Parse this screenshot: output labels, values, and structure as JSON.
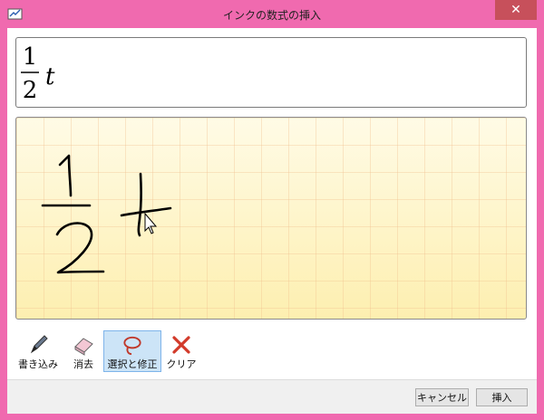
{
  "window": {
    "title": "インクの数式の挿入",
    "close_glyph": "✕"
  },
  "preview": {
    "numerator": "1",
    "denominator": "2",
    "variable": "t"
  },
  "toolbar": {
    "write_label": "書き込み",
    "erase_label": "消去",
    "select_correct_label": "選択と修正",
    "clear_label": "クリア"
  },
  "footer": {
    "cancel_label": "キャンセル",
    "insert_label": "挿入"
  },
  "colors": {
    "frame": "#f06aaf",
    "ink": "#000000",
    "selected_tool": "#cce4f7"
  }
}
